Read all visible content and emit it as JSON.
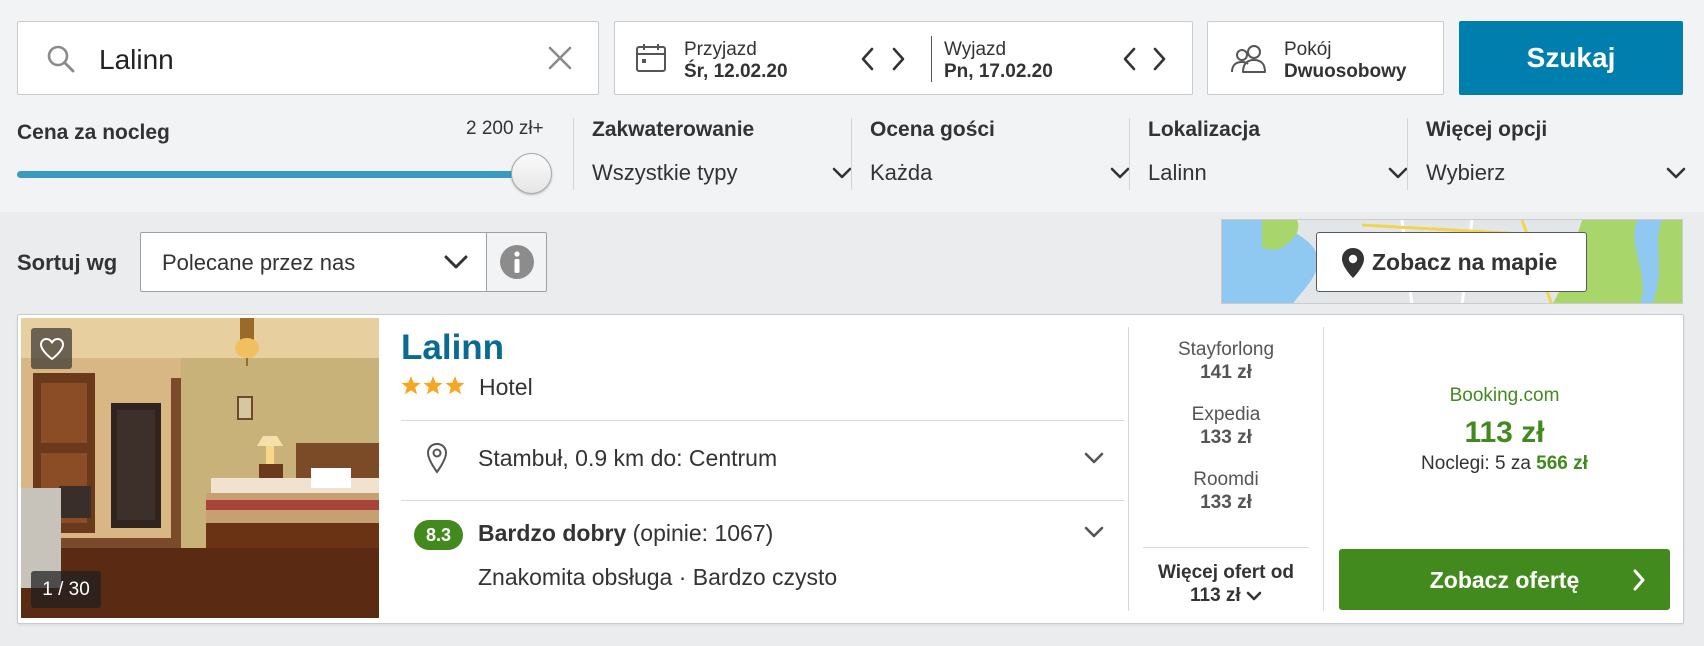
{
  "search": {
    "query": "Lalinn"
  },
  "dates": {
    "checkin_label": "Przyjazd",
    "checkin_value": "Śr, 12.02.20",
    "checkout_label": "Wyjazd",
    "checkout_value": "Pn, 17.02.20"
  },
  "room": {
    "label": "Pokój",
    "value": "Dwuosobowy"
  },
  "search_button": "Szukaj",
  "price_filter": {
    "label": "Cena za nocleg",
    "max_label": "2 200 zł+",
    "fill_percent": 100
  },
  "filters": [
    {
      "label": "Zakwaterowanie",
      "value": "Wszystkie typy"
    },
    {
      "label": "Ocena gości",
      "value": "Każda"
    },
    {
      "label": "Lokalizacja",
      "value": "Lalinn"
    },
    {
      "label": "Więcej opcji",
      "value": "Wybierz"
    }
  ],
  "sort": {
    "label": "Sortuj wg",
    "value": "Polecane przez nas"
  },
  "map_button": "Zobacz na mapie",
  "result": {
    "image_counter": "1 / 30",
    "name": "Lalinn",
    "stars": 3,
    "type": "Hotel",
    "location": "Stambuł, 0.9 km do: Centrum",
    "score": "8.3",
    "rating_text": "Bardzo dobry",
    "reviews": "(opinie: 1067)",
    "tags": "Znakomita obsługa · Bardzo czysto",
    "providers": [
      {
        "name": "Stayforlong",
        "price": "141 zł"
      },
      {
        "name": "Expedia",
        "price": "133 zł"
      },
      {
        "name": "Roomdi",
        "price": "133 zł"
      }
    ],
    "more_offers_line1": "Więcej ofert od",
    "more_offers_line2": "113 zł",
    "best_provider": "Booking.com",
    "best_price": "113 zł",
    "nights_text": "Noclegi: 5 za",
    "nights_total": "566 zł",
    "deal_button": "Zobacz ofertę"
  },
  "colors": {
    "accent_blue": "#007faf",
    "deal_green": "#428a1e",
    "title_blue": "#0b6a93",
    "star_orange": "#f5a623"
  }
}
